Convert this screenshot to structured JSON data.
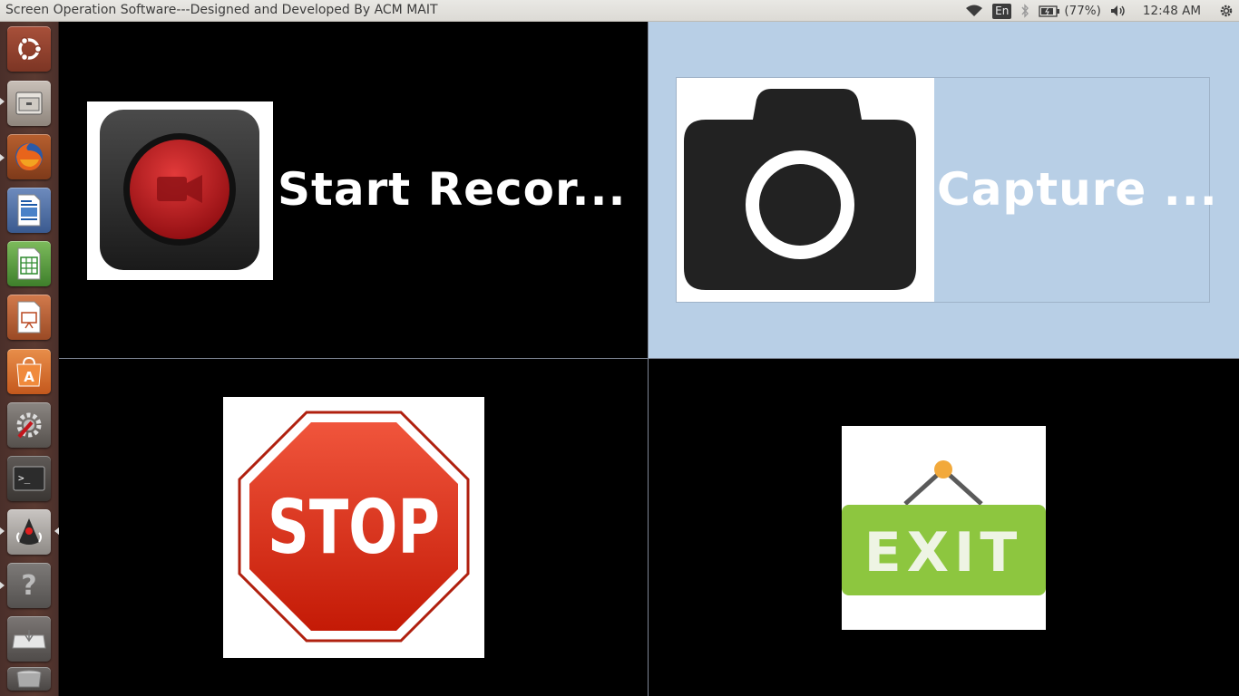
{
  "window": {
    "title": "Screen Operation Software---Designed and Developed By ACM MAIT"
  },
  "indicators": {
    "keyboard": "En",
    "battery": "(77%)",
    "time": "12:48 AM"
  },
  "launcher": {
    "items": [
      "ubuntu-dash",
      "files",
      "firefox",
      "libreoffice-writer",
      "libreoffice-calc",
      "libreoffice-impress",
      "software-center",
      "system-settings",
      "terminal",
      "java-app",
      "help",
      "usb-drive",
      "trash"
    ]
  },
  "buttons": {
    "record": {
      "label": "Start Recor..."
    },
    "capture": {
      "label": "Capture ..."
    },
    "stop": {
      "label": ""
    },
    "exit": {
      "label": ""
    }
  },
  "stop_sign_text": "STOP",
  "exit_sign_text": "EXIT",
  "colors": {
    "highlight": "#b8cfe6",
    "record_red": "#c3141b",
    "stop_red": "#d9200f",
    "exit_green": "#8dc63f",
    "exit_pin": "#f2a93b"
  }
}
